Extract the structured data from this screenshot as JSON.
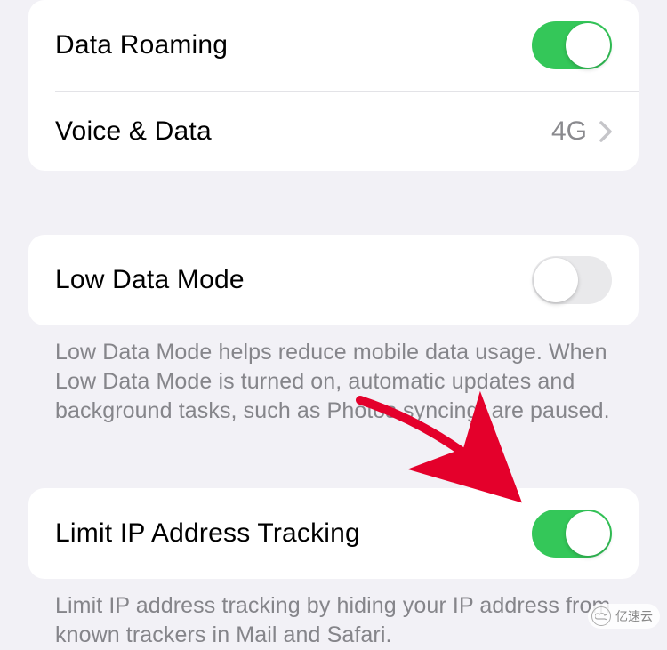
{
  "group1": {
    "dataRoaming": {
      "label": "Data Roaming",
      "on": true
    },
    "voiceData": {
      "label": "Voice & Data",
      "value": "4G"
    }
  },
  "group2": {
    "lowDataMode": {
      "label": "Low Data Mode",
      "on": false
    },
    "footer": "Low Data Mode helps reduce mobile data usage. When Low Data Mode is turned on, automatic updates and background tasks, such as Photos syncing, are paused."
  },
  "group3": {
    "limitIP": {
      "label": "Limit IP Address Tracking",
      "on": true
    },
    "footer": "Limit IP address tracking by hiding your IP address from known trackers in Mail and Safari."
  },
  "watermark": "亿速云"
}
